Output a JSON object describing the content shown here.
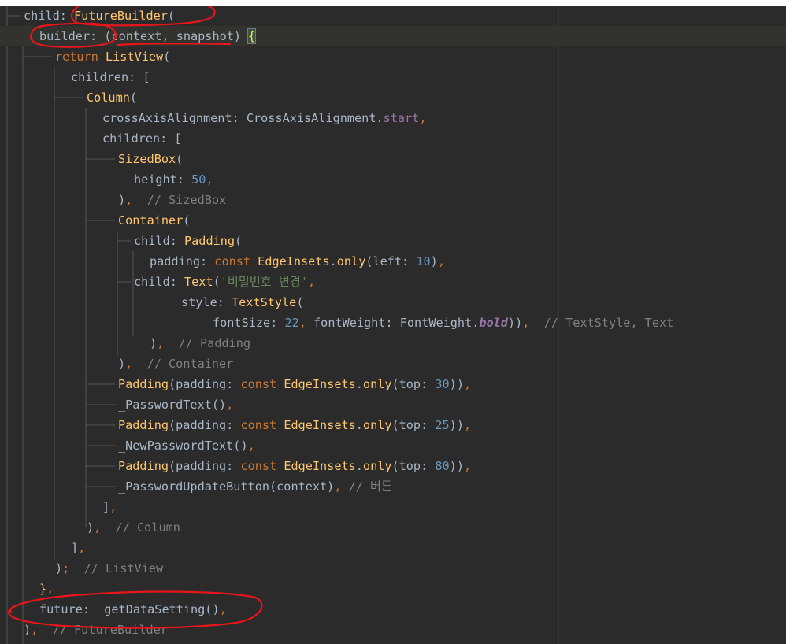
{
  "editor": {
    "colors": {
      "background": "#2b2b2b",
      "current_line": "#32332f",
      "default_text": "#a9b7c6",
      "class_name": "#ffc66d",
      "keyword": "#cc7832",
      "number": "#6897bb",
      "string": "#6a8759",
      "comment": "#808080",
      "property": "#9876aa",
      "annotation_red": "#e8151b"
    },
    "lines": [
      [
        {
          "t": "child: ",
          "c": "def"
        },
        {
          "t": "FutureBuilder",
          "c": "cls"
        },
        {
          "t": "(",
          "c": "def"
        }
      ],
      [
        {
          "t": "builder: (context, snapshot) ",
          "c": "def"
        },
        {
          "t": "{",
          "c": "brace"
        }
      ],
      [
        {
          "t": "return ",
          "c": "kw"
        },
        {
          "t": "ListView",
          "c": "cls"
        },
        {
          "t": "(",
          "c": "def"
        }
      ],
      [
        {
          "t": "children: [",
          "c": "def"
        }
      ],
      [
        {
          "t": "Column",
          "c": "cls"
        },
        {
          "t": "(",
          "c": "def"
        }
      ],
      [
        {
          "t": "crossAxisAlignment: CrossAxisAlignment.",
          "c": "def"
        },
        {
          "t": "start",
          "c": "prop"
        },
        {
          "t": ",",
          "c": "kw"
        }
      ],
      [
        {
          "t": "children: [",
          "c": "def"
        }
      ],
      [
        {
          "t": "SizedBox",
          "c": "cls"
        },
        {
          "t": "(",
          "c": "def"
        }
      ],
      [
        {
          "t": "height: ",
          "c": "def"
        },
        {
          "t": "50",
          "c": "num"
        },
        {
          "t": ",",
          "c": "kw"
        }
      ],
      [
        {
          "t": ")",
          "c": "def"
        },
        {
          "t": ",",
          "c": "kw"
        },
        {
          "t": "  // SizedBox",
          "c": "com"
        }
      ],
      [
        {
          "t": "Container",
          "c": "cls"
        },
        {
          "t": "(",
          "c": "def"
        }
      ],
      [
        {
          "t": "child: ",
          "c": "def"
        },
        {
          "t": "Padding",
          "c": "cls"
        },
        {
          "t": "(",
          "c": "def"
        }
      ],
      [
        {
          "t": "padding: ",
          "c": "def"
        },
        {
          "t": "const ",
          "c": "kw"
        },
        {
          "t": "EdgeInsets",
          "c": "cls"
        },
        {
          "t": ".",
          "c": "def"
        },
        {
          "t": "only",
          "c": "cls"
        },
        {
          "t": "(left: ",
          "c": "def"
        },
        {
          "t": "10",
          "c": "num"
        },
        {
          "t": ")",
          "c": "def"
        },
        {
          "t": ",",
          "c": "kw"
        }
      ],
      [
        {
          "t": "child: ",
          "c": "def"
        },
        {
          "t": "Text",
          "c": "cls"
        },
        {
          "t": "(",
          "c": "def"
        },
        {
          "t": "'비밀번호 변경'",
          "c": "str"
        },
        {
          "t": ",",
          "c": "kw"
        }
      ],
      [
        {
          "t": "style: ",
          "c": "def"
        },
        {
          "t": "TextStyle",
          "c": "cls"
        },
        {
          "t": "(",
          "c": "def"
        }
      ],
      [
        {
          "t": "fontSize: ",
          "c": "def"
        },
        {
          "t": "22",
          "c": "num"
        },
        {
          "t": ", ",
          "c": "kw"
        },
        {
          "t": "fontWeight: FontWeight.",
          "c": "def"
        },
        {
          "t": "bold",
          "c": "bold-it"
        },
        {
          "t": "))",
          "c": "def"
        },
        {
          "t": ",",
          "c": "kw"
        },
        {
          "t": "  // TextStyle, Text",
          "c": "com"
        }
      ],
      [
        {
          "t": ")",
          "c": "def"
        },
        {
          "t": ",",
          "c": "kw"
        },
        {
          "t": "  // Padding",
          "c": "com"
        }
      ],
      [
        {
          "t": ")",
          "c": "def"
        },
        {
          "t": ",",
          "c": "kw"
        },
        {
          "t": "  // Container",
          "c": "com"
        }
      ],
      [
        {
          "t": "Padding",
          "c": "cls"
        },
        {
          "t": "(padding: ",
          "c": "def"
        },
        {
          "t": "const ",
          "c": "kw"
        },
        {
          "t": "EdgeInsets",
          "c": "cls"
        },
        {
          "t": ".",
          "c": "def"
        },
        {
          "t": "only",
          "c": "cls"
        },
        {
          "t": "(top: ",
          "c": "def"
        },
        {
          "t": "30",
          "c": "num"
        },
        {
          "t": "))",
          "c": "def"
        },
        {
          "t": ",",
          "c": "kw"
        }
      ],
      [
        {
          "t": "_PasswordText()",
          "c": "def"
        },
        {
          "t": ",",
          "c": "kw"
        }
      ],
      [
        {
          "t": "Padding",
          "c": "cls"
        },
        {
          "t": "(padding: ",
          "c": "def"
        },
        {
          "t": "const ",
          "c": "kw"
        },
        {
          "t": "EdgeInsets",
          "c": "cls"
        },
        {
          "t": ".",
          "c": "def"
        },
        {
          "t": "only",
          "c": "cls"
        },
        {
          "t": "(top: ",
          "c": "def"
        },
        {
          "t": "25",
          "c": "num"
        },
        {
          "t": "))",
          "c": "def"
        },
        {
          "t": ",",
          "c": "kw"
        }
      ],
      [
        {
          "t": "_NewPasswordText()",
          "c": "def"
        },
        {
          "t": ",",
          "c": "kw"
        }
      ],
      [
        {
          "t": "Padding",
          "c": "cls"
        },
        {
          "t": "(padding: ",
          "c": "def"
        },
        {
          "t": "const ",
          "c": "kw"
        },
        {
          "t": "EdgeInsets",
          "c": "cls"
        },
        {
          "t": ".",
          "c": "def"
        },
        {
          "t": "only",
          "c": "cls"
        },
        {
          "t": "(top: ",
          "c": "def"
        },
        {
          "t": "80",
          "c": "num"
        },
        {
          "t": "))",
          "c": "def"
        },
        {
          "t": ",",
          "c": "kw"
        }
      ],
      [
        {
          "t": "_PasswordUpdateButton(context)",
          "c": "def"
        },
        {
          "t": ",",
          "c": "kw"
        },
        {
          "t": " // 버튼",
          "c": "com"
        }
      ],
      [
        {
          "t": "]",
          "c": "def"
        },
        {
          "t": ",",
          "c": "kw"
        }
      ],
      [
        {
          "t": ")",
          "c": "def"
        },
        {
          "t": ",",
          "c": "kw"
        },
        {
          "t": "  // Column",
          "c": "com"
        }
      ],
      [
        {
          "t": "]",
          "c": "def"
        },
        {
          "t": ",",
          "c": "kw"
        }
      ],
      [
        {
          "t": ")",
          "c": "def"
        },
        {
          "t": ";",
          "c": "kw"
        },
        {
          "t": "  // ListView",
          "c": "com"
        }
      ],
      [
        {
          "t": "}",
          "c": "gen"
        },
        {
          "t": ",",
          "c": "kw"
        }
      ],
      [
        {
          "t": "future: _getDataSetting()",
          "c": "def"
        },
        {
          "t": ",",
          "c": "kw"
        }
      ],
      [
        {
          "t": ")",
          "c": "def"
        },
        {
          "t": ",",
          "c": "kw"
        },
        {
          "t": "  // FutureBuilder",
          "c": "com"
        }
      ]
    ]
  }
}
